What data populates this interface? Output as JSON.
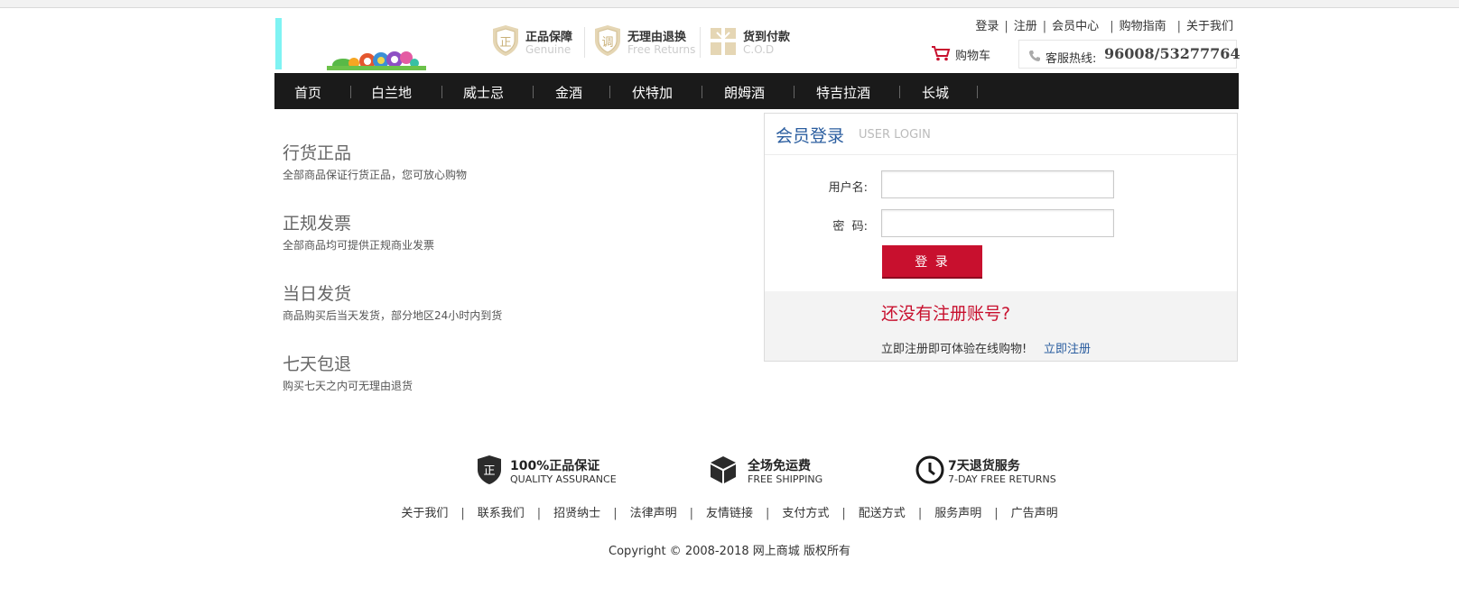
{
  "header": {
    "badges": [
      {
        "title": "正品保障",
        "subtitle": "Genuine",
        "icon": "zheng-shield-icon"
      },
      {
        "title": "无理由退换",
        "subtitle": "Free Returns",
        "icon": "diao-shield-icon"
      },
      {
        "title": "货到付款",
        "subtitle": "C.O.D",
        "icon": "gift-box-icon"
      }
    ],
    "top_links": [
      "登录",
      "注册",
      "会员中心",
      "购物指南",
      "关于我们"
    ],
    "top_link_separator": "|",
    "cart_label": "购物车",
    "hotline_label": "客服热线:",
    "hotline_number": "96008/53277764"
  },
  "nav": {
    "items": [
      "首页",
      "白兰地",
      "威士忌",
      "金酒",
      "伏特加",
      "朗姆酒",
      "特吉拉酒",
      "长城"
    ],
    "separator": "|"
  },
  "features": [
    {
      "title": "行货正品",
      "desc": "全部商品保证行货正品，您可放心购物"
    },
    {
      "title": "正规发票",
      "desc": "全部商品均可提供正规商业发票"
    },
    {
      "title": "当日发货",
      "desc": "商品购买后当天发货，部分地区24小时内到货"
    },
    {
      "title": "七天包退",
      "desc": "购买七天之内可无理由退货"
    }
  ],
  "login": {
    "title_zh": "会员登录",
    "title_en": "USER LOGIN",
    "username_label": "用户名:",
    "username_value": "",
    "password_label": "密  码:",
    "password_value": "",
    "submit_label": "登 录",
    "register_question": "还没有注册账号?",
    "register_text": "立即注册即可体验在线购物!",
    "register_link": "立即注册"
  },
  "footer": {
    "assurances": [
      {
        "title": "100%正品保证",
        "subtitle": "QUALITY ASSURANCE",
        "icon": "zheng-shield-icon"
      },
      {
        "title": "全场免运费",
        "subtitle": "FREE SHIPPING",
        "icon": "box-icon"
      },
      {
        "title": "7天退货服务",
        "subtitle": "7-DAY FREE RETURNS",
        "icon": "clock-icon"
      }
    ],
    "links": [
      "关于我们",
      "联系我们",
      "招贤纳士",
      "法律声明",
      "友情链接",
      "支付方式",
      "配送方式",
      "服务声明",
      "广告声明"
    ],
    "link_separator": "|",
    "copyright": "Copyright © 2008-2018 网上商城 版权所有"
  },
  "colors": {
    "accent_red": "#c8102e",
    "nav_bg": "#1a1a1a",
    "link_blue": "#2a5d9f"
  }
}
